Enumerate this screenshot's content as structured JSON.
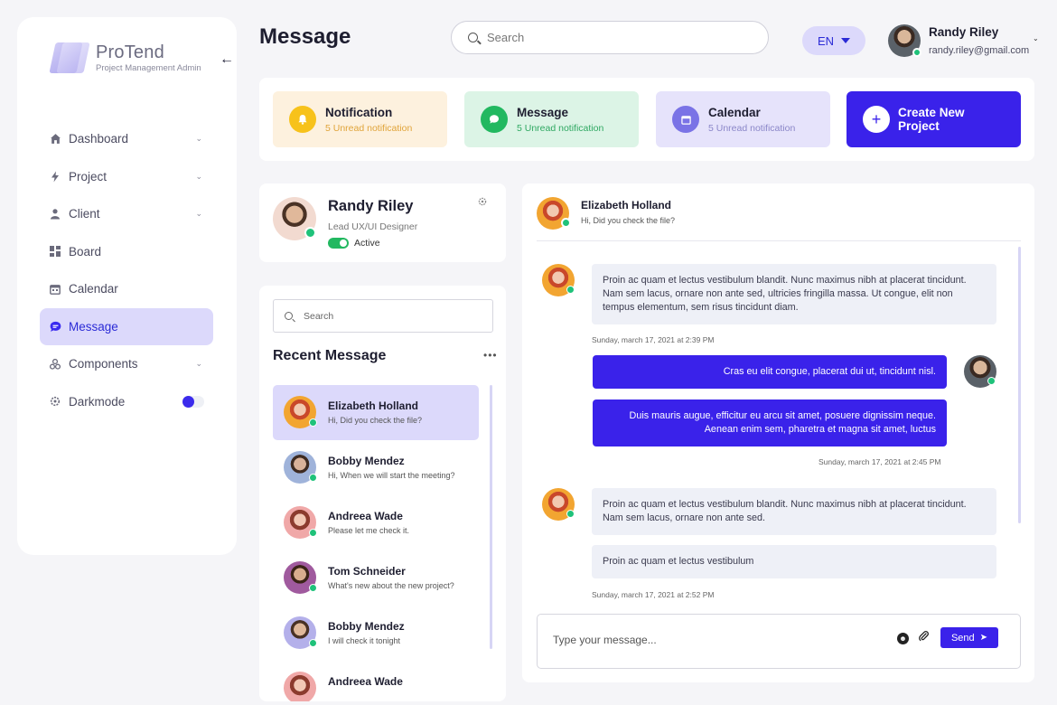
{
  "brand": {
    "name": "ProTend",
    "tagline": "Project Management Admin"
  },
  "sidebar": {
    "items": [
      {
        "label": "Dashboard",
        "icon": "home-icon"
      },
      {
        "label": "Project",
        "icon": "bolt-icon"
      },
      {
        "label": "Client",
        "icon": "user-icon"
      },
      {
        "label": "Board",
        "icon": "grid-icon"
      },
      {
        "label": "Calendar",
        "icon": "calendar-icon"
      },
      {
        "label": "Message",
        "icon": "chat-icon"
      },
      {
        "label": "Components",
        "icon": "components-icon"
      },
      {
        "label": "Darkmode",
        "icon": "gear-icon"
      }
    ],
    "active": "Message",
    "darkmode_on": false
  },
  "header": {
    "title": "Message",
    "search_placeholder": "Search",
    "language": "EN",
    "user": {
      "name": "Randy Riley",
      "email": "randy.riley@gmail.com"
    }
  },
  "stats": {
    "notification": {
      "title": "Notification",
      "sub": "5 Unread notification"
    },
    "message": {
      "title": "Message",
      "sub": "5 Unread notification"
    },
    "calendar": {
      "title": "Calendar",
      "sub": "5 Unread notification"
    },
    "create_label": "Create New Project"
  },
  "profile": {
    "name": "Randy Riley",
    "role": "Lead UX/UI Designer",
    "status": "Active"
  },
  "messages": {
    "search_placeholder": "Search",
    "heading": "Recent Message",
    "more": "•••",
    "list": [
      {
        "name": "Elizabeth Holland",
        "preview": "Hi, Did you check the file?"
      },
      {
        "name": "Bobby Mendez",
        "preview": "Hi, When we will start the meeting?"
      },
      {
        "name": "Andreea Wade",
        "preview": "Please let me check it."
      },
      {
        "name": "Tom Schneider",
        "preview": "What's new about the new project?"
      },
      {
        "name": "Bobby Mendez",
        "preview": "I will check it tonight"
      },
      {
        "name": "Andreea Wade",
        "preview": ""
      }
    ]
  },
  "chat": {
    "contact": {
      "name": "Elizabeth Holland",
      "preview": "Hi, Did you check the file?"
    },
    "m1": "Proin ac quam et lectus vestibulum blandit. Nunc maximus nibh at placerat tincidunt. Nam sem lacus, ornare non ante sed, ultricies fringilla massa. Ut congue, elit non tempus elementum, sem risus tincidunt diam.",
    "t1": "Sunday, march 17, 2021 at 2:39 PM",
    "m2": "Cras eu elit congue, placerat dui ut, tincidunt nisl.",
    "m3": "Duis mauris augue, efficitur eu arcu sit amet, posuere dignissim neque. Aenean enim sem, pharetra et magna sit amet, luctus",
    "t2": "Sunday, march 17, 2021 at 2:45 PM",
    "m4": "Proin ac quam et lectus vestibulum blandit. Nunc maximus nibh at placerat tincidunt. Nam sem lacus, ornare non ante sed.",
    "m5": "Proin ac quam et lectus vestibulum",
    "t3": "Sunday, march 17, 2021 at 2:52 PM",
    "composer_placeholder": "Type your message...",
    "send_label": "Send"
  }
}
